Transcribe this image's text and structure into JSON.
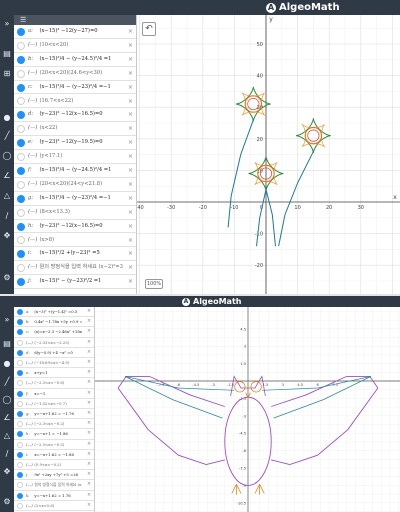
{
  "app": {
    "logo_text": "AlgeoMath",
    "logo_mark": "A"
  },
  "screen1": {
    "algebra_header": "☰",
    "rows": [
      {
        "label": "a:",
        "expr": "(x−15)² −12(y−27)=0",
        "visible": true
      },
      {
        "label": "(—)",
        "expr": "(10<x<20)",
        "visible": false
      },
      {
        "label": "b:",
        "expr": "(x−15)²/4 − (y−24.5)²/4 =1",
        "visible": true
      },
      {
        "label": "(—)",
        "expr": "(20<x<20)(24.6<y<30)",
        "visible": false
      },
      {
        "label": "c:",
        "expr": "(x−15)²/4 − (y−23)²/4 =−1",
        "visible": true
      },
      {
        "label": "(—)",
        "expr": "(16.7<x<22)",
        "visible": false
      },
      {
        "label": "d:",
        "expr": "(y−23)² −12(x−16.5)=0",
        "visible": true
      },
      {
        "label": "(—)",
        "expr": "(x<22)",
        "visible": false
      },
      {
        "label": "e:",
        "expr": "(y−23)² −12(y−19.5)=0",
        "visible": true
      },
      {
        "label": "(—)",
        "expr": "(y<17.1)",
        "visible": false
      },
      {
        "label": "f:",
        "expr": "(x−15)²/4 − (y−24.5)²/4 =1",
        "visible": true
      },
      {
        "label": "(—)",
        "expr": "(20<x<20)(24<y<21.8)",
        "visible": false
      },
      {
        "label": "g:",
        "expr": "(x−15)²/4 − (y−23)²/4 =−1",
        "visible": true
      },
      {
        "label": "(—)",
        "expr": "(8<x<13.3)",
        "visible": false
      },
      {
        "label": "h:",
        "expr": "(y−23)² −12(x−16.5)=0",
        "visible": true
      },
      {
        "label": "(—)",
        "expr": "(x>8)",
        "visible": false
      },
      {
        "label": "i:",
        "expr": "(x−15)²/2 +(y−23)² =5",
        "visible": true
      },
      {
        "label": "(—)",
        "expr": "원의 방정식을 입력 하세요 (x−2)²=3",
        "visible": false
      },
      {
        "label": "j:",
        "expr": "(x−15)² − (y−23)²/2 =1",
        "visible": true
      }
    ],
    "graph": {
      "x_ticks": [
        "-40",
        "-30",
        "-20",
        "-10",
        "0",
        "10",
        "20",
        "30"
      ],
      "y_ticks": [
        "50",
        "40",
        "30",
        "20",
        "10",
        "-10",
        "-20",
        "-30"
      ],
      "x_axis_label": "x",
      "y_axis_label": "y",
      "undo_icon": "↶",
      "zoom_label": "100%",
      "colors": {
        "green": "#2e8b3a",
        "orange": "#e07a1f",
        "teal": "#1a7aa0",
        "grid": "#e6e6e6",
        "axis": "#444444"
      }
    }
  },
  "screen2": {
    "rows": [
      {
        "label": "a:",
        "expr": "(x−3)² +(y−1.4)² =0.5",
        "visible": true
      },
      {
        "label": "b:",
        "expr": "0.4x² −1.78x +5y +0.9 =0",
        "visible": true
      },
      {
        "label": "c:",
        "expr": "(x)=x−2.3 −2.46x² +18xy −3.8",
        "visible": true
      },
      {
        "label": "(—)",
        "expr": "(−2.33<x<−2.25)",
        "visible": false
      },
      {
        "label": "d:",
        "expr": "6(y−0.9) +4 −x² =0",
        "visible": true
      },
      {
        "label": "(—)",
        "expr": "(−18.69<x<−4.9)",
        "visible": false
      },
      {
        "label": "e:",
        "expr": "x+y=1",
        "visible": true
      },
      {
        "label": "(—)",
        "expr": "(−2.3<x<−0.8)",
        "visible": false
      },
      {
        "label": "f:",
        "expr": "x=−1",
        "visible": true
      },
      {
        "label": "(—)",
        "expr": "(−1.52<x<−0.7)",
        "visible": false
      },
      {
        "label": "g:",
        "expr": "y=−x+1.62 = −1.76",
        "visible": true
      },
      {
        "label": "(—)",
        "expr": "(−2.3<x<−0.2)",
        "visible": false
      },
      {
        "label": "h:",
        "expr": "y=−x+1 = −1.86",
        "visible": true
      },
      {
        "label": "(—)",
        "expr": "(−2.5<x<−0.5)",
        "visible": false
      },
      {
        "label": "i:",
        "expr": "x=−x+1.62 = −1.86",
        "visible": true
      },
      {
        "label": "(—)",
        "expr": "(0.9<x<−0.2)",
        "visible": false
      },
      {
        "label": "j:",
        "expr": "9x² +2xy +7y² +5 =26",
        "visible": true
      },
      {
        "label": "(—)",
        "expr": "원의 방정식을 입력 하세요 (x−2)²=3",
        "visible": false
      },
      {
        "label": "k:",
        "expr": "y=−x+1.62 = 1.76",
        "visible": true
      },
      {
        "label": "(—)",
        "expr": "(2<x<5.6)",
        "visible": false
      }
    ],
    "graph": {
      "x_ticks": [
        "-7.5",
        "-6",
        "-4.5",
        "-3",
        "-1.5",
        "1.5",
        "3",
        "4.5",
        "6",
        "7.5"
      ],
      "y_ticks": [
        "4.5",
        "3",
        "1.5",
        "-1.5",
        "-3",
        "-4.5",
        "-6",
        "-7.5",
        "-9",
        "-10.5",
        "-12"
      ],
      "colors": {
        "purple": "#9b4fc8",
        "teal": "#2a8a9c",
        "orange": "#e5861f"
      }
    }
  }
}
